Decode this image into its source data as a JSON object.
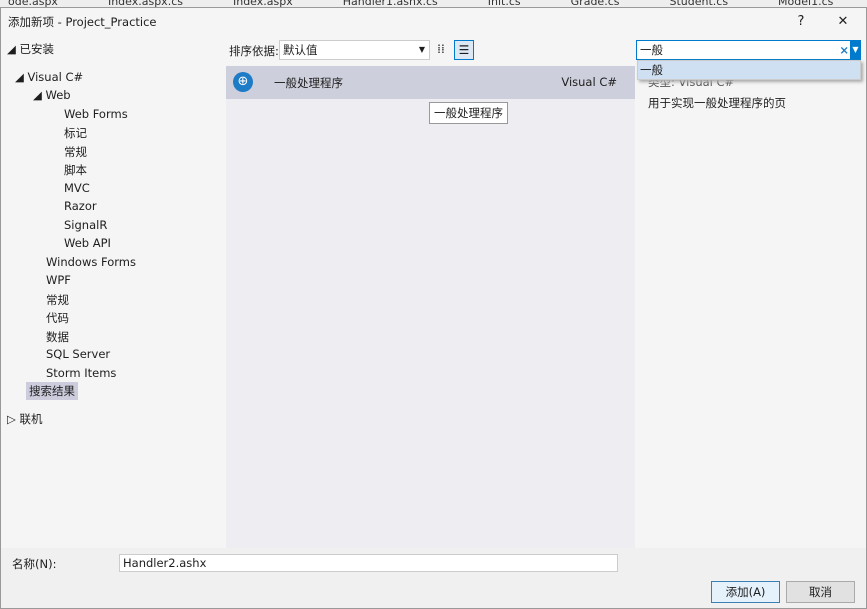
{
  "editor_tabs": [
    "ode.aspx",
    "Index.aspx.cs",
    "Index.aspx",
    "Handler1.ashx.cs",
    "Init.cs",
    "Grade.cs",
    "Student.cs",
    "Model1.cs"
  ],
  "dialog": {
    "title": "添加新项 - Project_Practice",
    "help": "?",
    "close": "✕"
  },
  "tree": {
    "installed": "已安装",
    "visual_csharp": "Visual C#",
    "web": "Web",
    "web_children": [
      "Web Forms",
      "标记",
      "常规",
      "脚本",
      "MVC",
      "Razor",
      "SignalR",
      "Web API"
    ],
    "csharp_children": [
      "Windows Forms",
      "WPF",
      "常规",
      "代码",
      "数据",
      "SQL Server",
      "Storm Items"
    ],
    "search_results": "搜索结果",
    "online": "联机"
  },
  "toolbar": {
    "sort_label": "排序依据:",
    "sort_value": "默认值"
  },
  "templates": [
    {
      "name": "一般处理程序",
      "language": "Visual C#"
    }
  ],
  "tooltip": "一般处理程序",
  "search": {
    "value": "一般",
    "suggestion": "一般"
  },
  "details": {
    "type": "类型: Visual C#",
    "description": "用于实现一般处理程序的页"
  },
  "name_field": {
    "label": "名称(N):",
    "value": "Handler2.ashx"
  },
  "buttons": {
    "add": "添加(A)",
    "cancel": "取消"
  },
  "accent": "#007acc"
}
